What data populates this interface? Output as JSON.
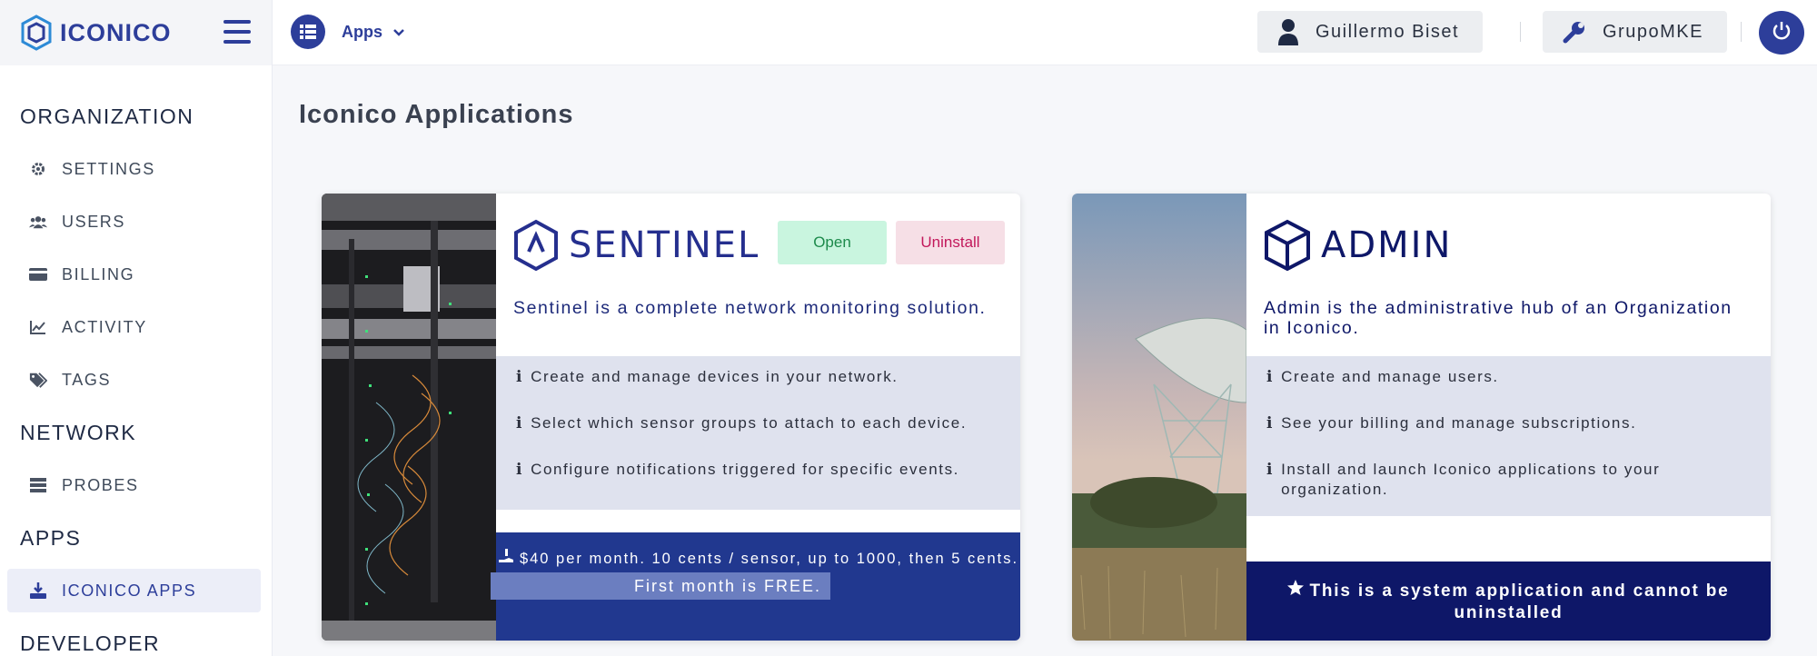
{
  "brand": {
    "name": "ICONICO"
  },
  "topbar": {
    "apps_label": "Apps",
    "user_name": "Guillermo Biset",
    "org_name": "GrupoMKE"
  },
  "sidebar": {
    "sections": [
      {
        "title": "ORGANIZATION",
        "items": [
          {
            "label": "SETTINGS",
            "icon": "gear-icon"
          },
          {
            "label": "USERS",
            "icon": "users-icon"
          },
          {
            "label": "BILLING",
            "icon": "credit-card-icon"
          },
          {
            "label": "ACTIVITY",
            "icon": "line-chart-icon"
          },
          {
            "label": "TAGS",
            "icon": "tags-icon"
          }
        ]
      },
      {
        "title": "NETWORK",
        "items": [
          {
            "label": "PROBES",
            "icon": "server-icon"
          }
        ]
      },
      {
        "title": "APPS",
        "items": [
          {
            "label": "ICONICO APPS",
            "icon": "download-icon",
            "active": true
          }
        ]
      },
      {
        "title": "DEVELOPER",
        "items": []
      }
    ]
  },
  "main": {
    "title": "Iconico Applications",
    "apps": [
      {
        "name": "SENTINEL",
        "open_label": "Open",
        "uninstall_label": "Uninstall",
        "description": "Sentinel is a complete network monitoring solution.",
        "features": [
          "Create and manage devices in your network.",
          "Select which sensor groups to attach to each device.",
          "Configure notifications triggered for specific events."
        ],
        "price": "$40 per month. 10 cents / sensor, up to 1000, then 5 cents.",
        "free_note": "First month is FREE."
      },
      {
        "name": "ADMIN",
        "description": "Admin is the administrative hub of an Organization in Iconico.",
        "features": [
          "Create and manage users.",
          "See your billing and manage subscriptions.",
          "Install and launch Iconico applications to your organization."
        ],
        "system_note": "This is a system application and cannot be uninstalled"
      }
    ]
  },
  "colors": {
    "primary": "#2d3e9a",
    "price_bg": "#21388f",
    "system_bg": "#0e1768",
    "open_bg": "#c9f5df",
    "uninstall_bg": "#f6dfe6"
  }
}
